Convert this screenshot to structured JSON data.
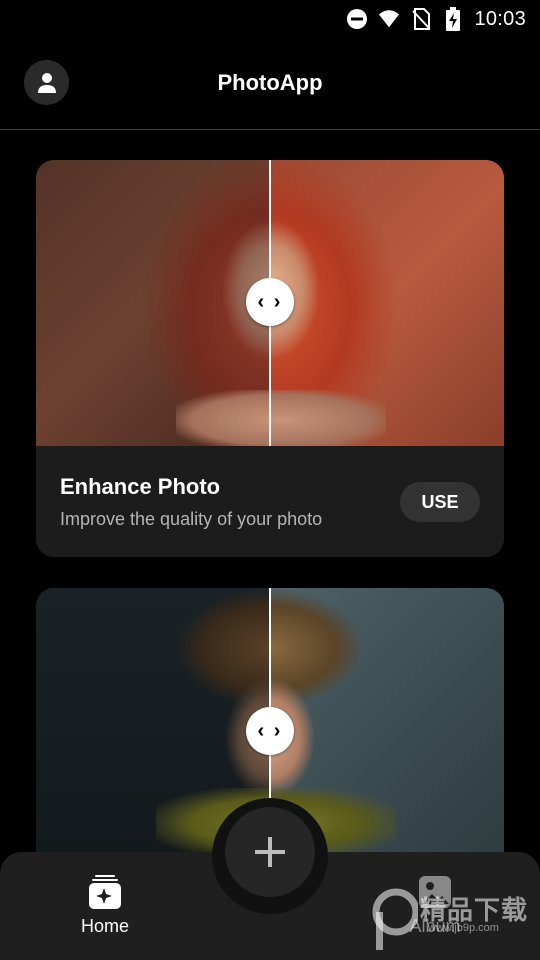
{
  "status_bar": {
    "time": "10:03",
    "icons": [
      "do-not-disturb-icon",
      "wifi-icon",
      "no-sim-icon",
      "battery-charging-icon"
    ]
  },
  "app_bar": {
    "title": "PhotoApp",
    "avatar_icon": "person-icon"
  },
  "cards": [
    {
      "title": "Enhance Photo",
      "subtitle": "Improve the quality of your photo",
      "action_label": "USE",
      "compare_handle": "‹ ›"
    },
    {
      "compare_handle": "‹ ›"
    }
  ],
  "bottom_nav": {
    "items": [
      {
        "label": "Home",
        "icon": "sparkle-stack-icon",
        "active": true
      },
      {
        "label": "Album",
        "icon": "image-icon",
        "active": false
      }
    ],
    "fab_icon": "plus-icon"
  },
  "watermark": {
    "text": "精品下载",
    "url": "www.jb9p.com"
  },
  "colors": {
    "background": "#000000",
    "card": "#1c1c1c",
    "button": "#333333",
    "nav": "#1f1f1f"
  }
}
